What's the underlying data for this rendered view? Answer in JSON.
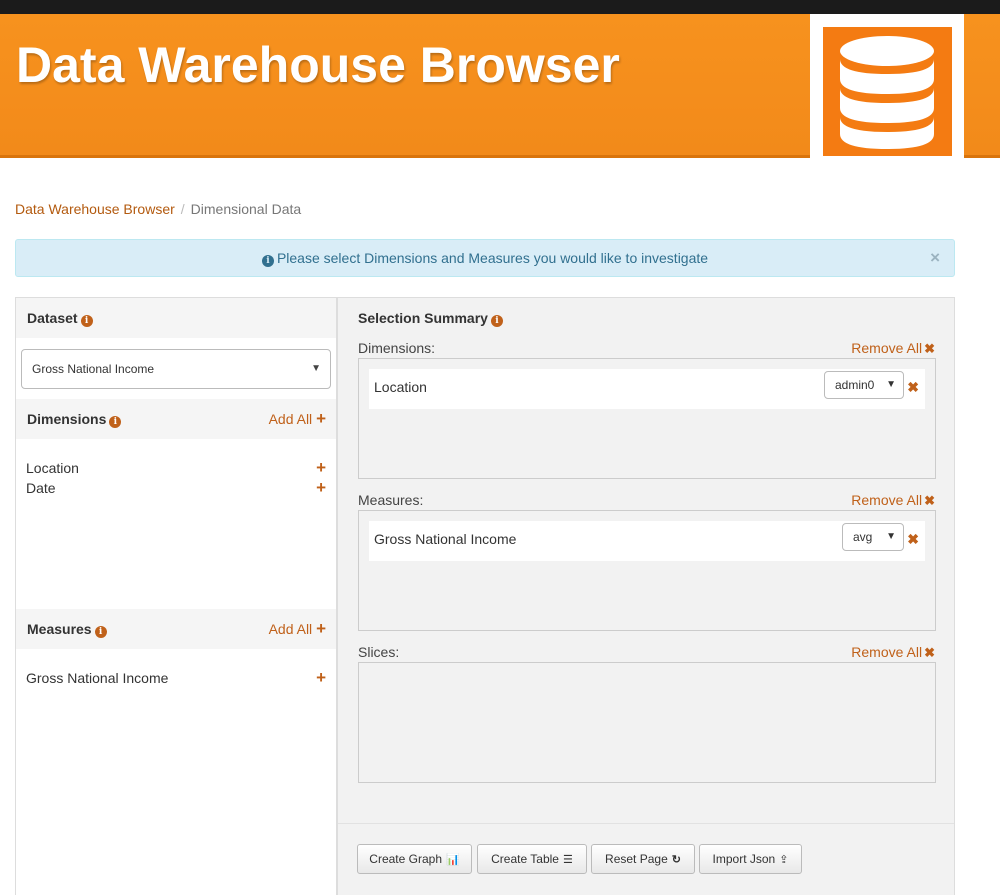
{
  "header": {
    "title": "Data Warehouse Browser",
    "brand_color": "#f7921e",
    "logo_icon": "database-icon"
  },
  "breadcrumb": {
    "items": [
      "Data Warehouse Browser",
      "Dimensional Data"
    ]
  },
  "alert": {
    "message": "Please select Dimensions and Measures you would like to investigate",
    "close": "×"
  },
  "left_panel": {
    "dataset": {
      "heading": "Dataset",
      "selected": "Gross National Income"
    },
    "dimensions": {
      "heading": "Dimensions",
      "add_all": "Add All",
      "items": [
        "Location",
        "Date"
      ]
    },
    "measures": {
      "heading": "Measures",
      "add_all": "Add All",
      "items": [
        "Gross National Income"
      ]
    }
  },
  "summary": {
    "heading": "Selection Summary",
    "remove_all": "Remove All",
    "dimensions": {
      "label": "Dimensions:",
      "rows": [
        {
          "name": "Location",
          "level": "admin0"
        }
      ]
    },
    "measures": {
      "label": "Measures:",
      "rows": [
        {
          "name": "Gross National Income",
          "aggregate": "avg"
        }
      ]
    },
    "slices": {
      "label": "Slices:",
      "rows": []
    }
  },
  "buttons": {
    "create_graph": "Create Graph",
    "create_table": "Create Table",
    "reset_page": "Reset Page",
    "import_json": "Import Json"
  },
  "colors": {
    "accent": "#c0611a",
    "alert_bg": "#d9edf7",
    "alert_text": "#31708f"
  }
}
